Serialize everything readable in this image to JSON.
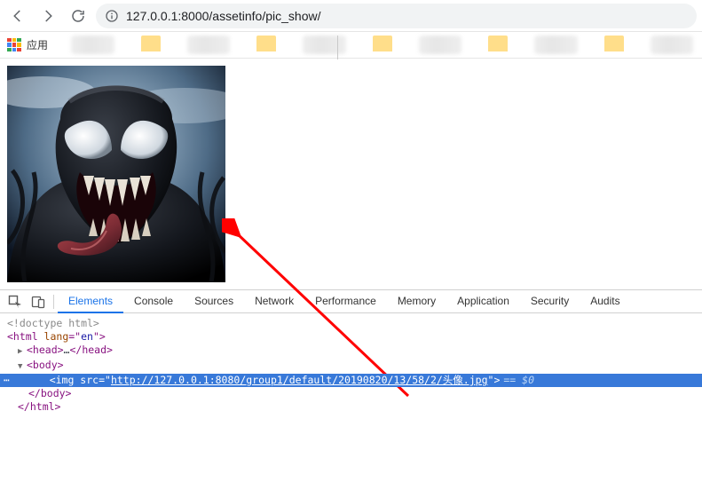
{
  "browser": {
    "url": "127.0.0.1:8000/assetinfo/pic_show/",
    "apps_label": "应用"
  },
  "devtools": {
    "tabs": [
      "Elements",
      "Console",
      "Sources",
      "Network",
      "Performance",
      "Memory",
      "Application",
      "Security",
      "Audits"
    ],
    "active_tab_index": 0,
    "source": {
      "doctype": "<!doctype html>",
      "html_open": "<html lang=\"en\">",
      "head_collapsed": "<head>…</head>",
      "body_open": "<body>",
      "img_tag_prefix": "<img src=\"",
      "img_src_url": "http://127.0.0.1:8080/group1/default/20190820/13/58/2/头像.jpg",
      "img_tag_suffix": "\">",
      "eq0": " == $0",
      "body_close": "</body>",
      "html_close": "</html>"
    }
  }
}
